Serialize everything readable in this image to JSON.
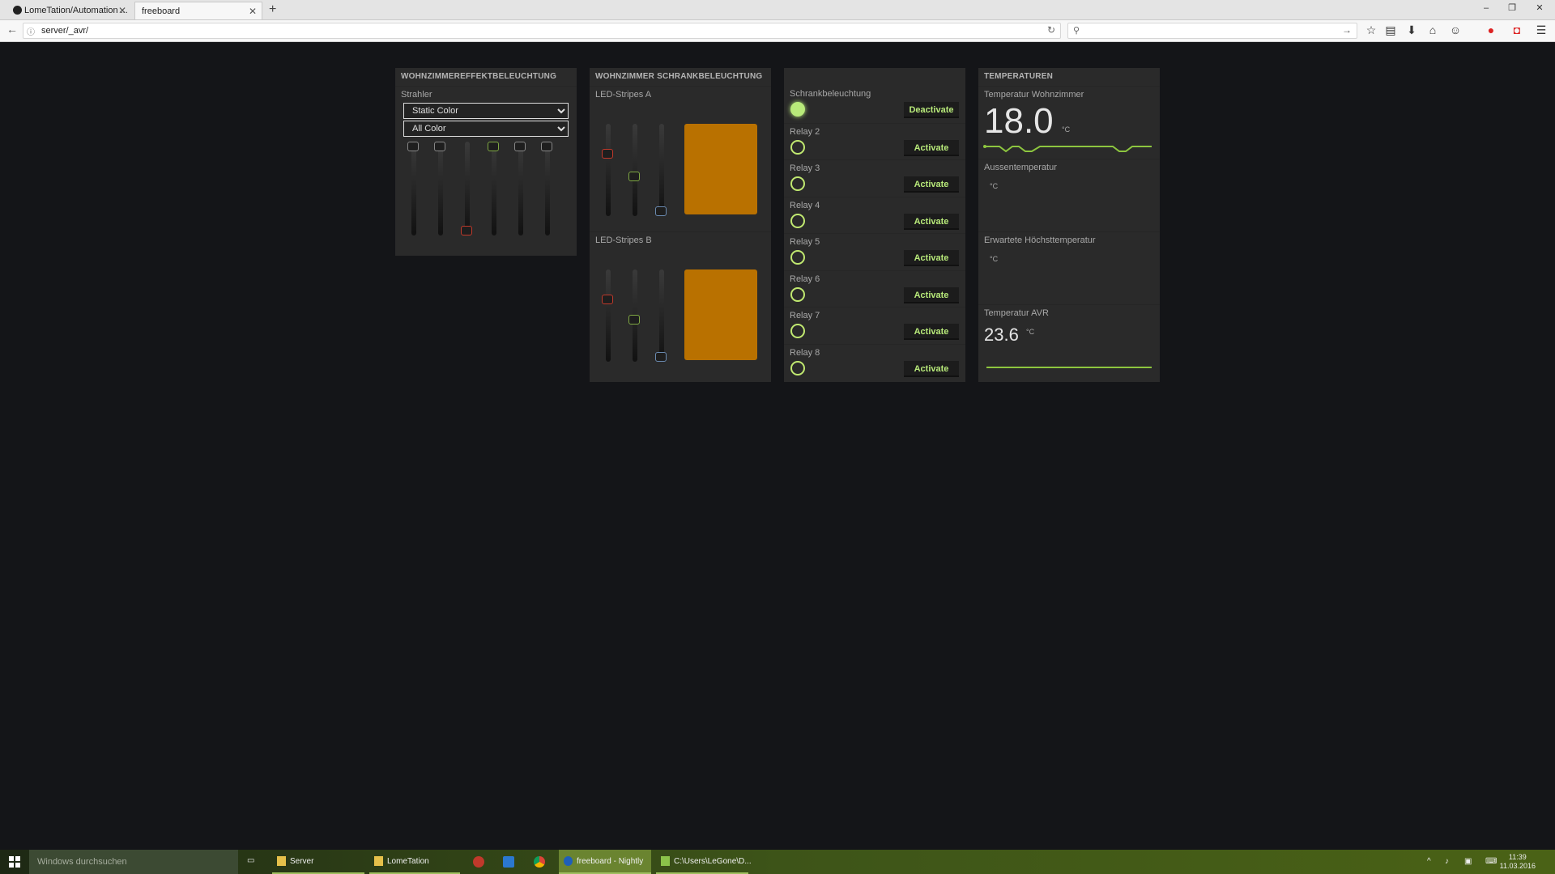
{
  "browser": {
    "tabs": [
      {
        "label": "LomeTation/Automation ..."
      },
      {
        "label": "freeboard"
      }
    ],
    "url": "server/_avr/"
  },
  "panes": {
    "effekt": {
      "title": "WOHNZIMMEREFFEKTBELEUCHTUNG",
      "widget_label": "Strahler",
      "dropdown1": "Static Color",
      "dropdown2": "All Color",
      "slider_levels": [
        1.0,
        1.0,
        0.0,
        1.0,
        1.0,
        1.0
      ],
      "slider_colors": [
        "#888888",
        "#888888",
        "#c0392b",
        "#7fa843",
        "#888888",
        "#888888"
      ]
    },
    "schrank": {
      "title": "WOHNZIMMER SCHRANKBELEUCHTUNG",
      "stripe_a": {
        "label": "LED-Stripes A",
        "levels": [
          0.7,
          0.42,
          0.0
        ],
        "color": "#b97100"
      },
      "stripe_b": {
        "label": "LED-Stripes B",
        "levels": [
          0.7,
          0.45,
          0.0
        ],
        "color": "#b97100"
      },
      "slider_colors": [
        "#c0392b",
        "#7fa843",
        "#6a8ab0"
      ]
    },
    "relays": [
      {
        "label": "Schrankbeleuchtung",
        "button": "Deactivate",
        "on": true
      },
      {
        "label": "Relay 2",
        "button": "Activate",
        "on": false
      },
      {
        "label": "Relay 3",
        "button": "Activate",
        "on": false
      },
      {
        "label": "Relay 4",
        "button": "Activate",
        "on": false
      },
      {
        "label": "Relay 5",
        "button": "Activate",
        "on": false
      },
      {
        "label": "Relay 6",
        "button": "Activate",
        "on": false
      },
      {
        "label": "Relay 7",
        "button": "Activate",
        "on": false
      },
      {
        "label": "Relay 8",
        "button": "Activate",
        "on": false
      }
    ],
    "temperaturen": {
      "title": "TEMPERATUREN",
      "wohnzimmer": {
        "label": "Temperatur Wohnzimmer",
        "value": "18.0",
        "unit": "°C"
      },
      "aussen": {
        "label": "Aussentemperatur",
        "unit": "°C"
      },
      "hoechst": {
        "label": "Erwartete Höchsttemperatur",
        "unit": "°C"
      },
      "avr": {
        "label": "Temperatur AVR",
        "value": "23.6",
        "unit": "°C"
      },
      "accent": "#8dc63f"
    }
  },
  "taskbar": {
    "search_placeholder": "Windows durchsuchen",
    "items": [
      {
        "label": "Server"
      },
      {
        "label": "LomeTation"
      },
      {
        "label": "freeboard - Nightly"
      },
      {
        "label": "C:\\Users\\LeGone\\D..."
      }
    ],
    "time": "11:39",
    "date": "11.03.2016"
  }
}
